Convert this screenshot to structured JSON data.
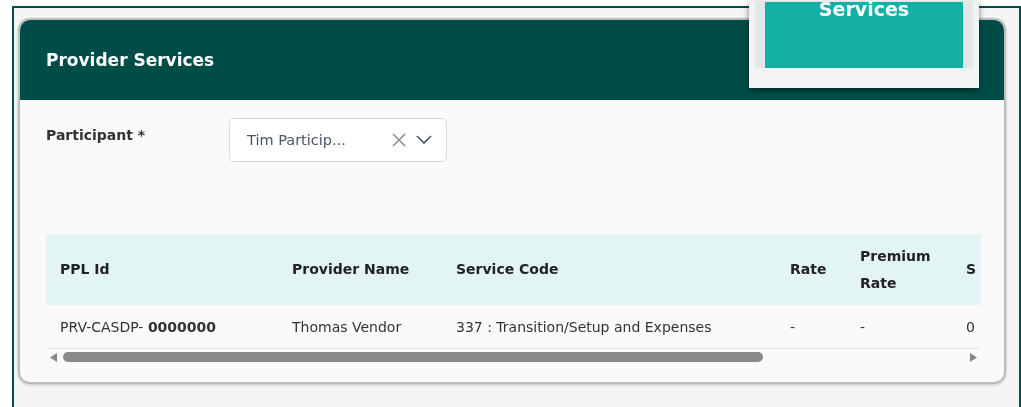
{
  "card": {
    "title": "Provider Services"
  },
  "overlay": {
    "label": "Services"
  },
  "participant": {
    "label": "Participant *",
    "value": "Tim Particip..."
  },
  "table": {
    "columns": [
      "PPL Id",
      "Provider Name",
      "Service Code",
      "Rate",
      "Premium Rate",
      "S"
    ],
    "rows": [
      [
        "PRV-CASDP- **0000000**",
        "Thomas Vendor",
        "337 : Transition/Setup and Expenses",
        "-",
        "-",
        "0"
      ]
    ]
  }
}
